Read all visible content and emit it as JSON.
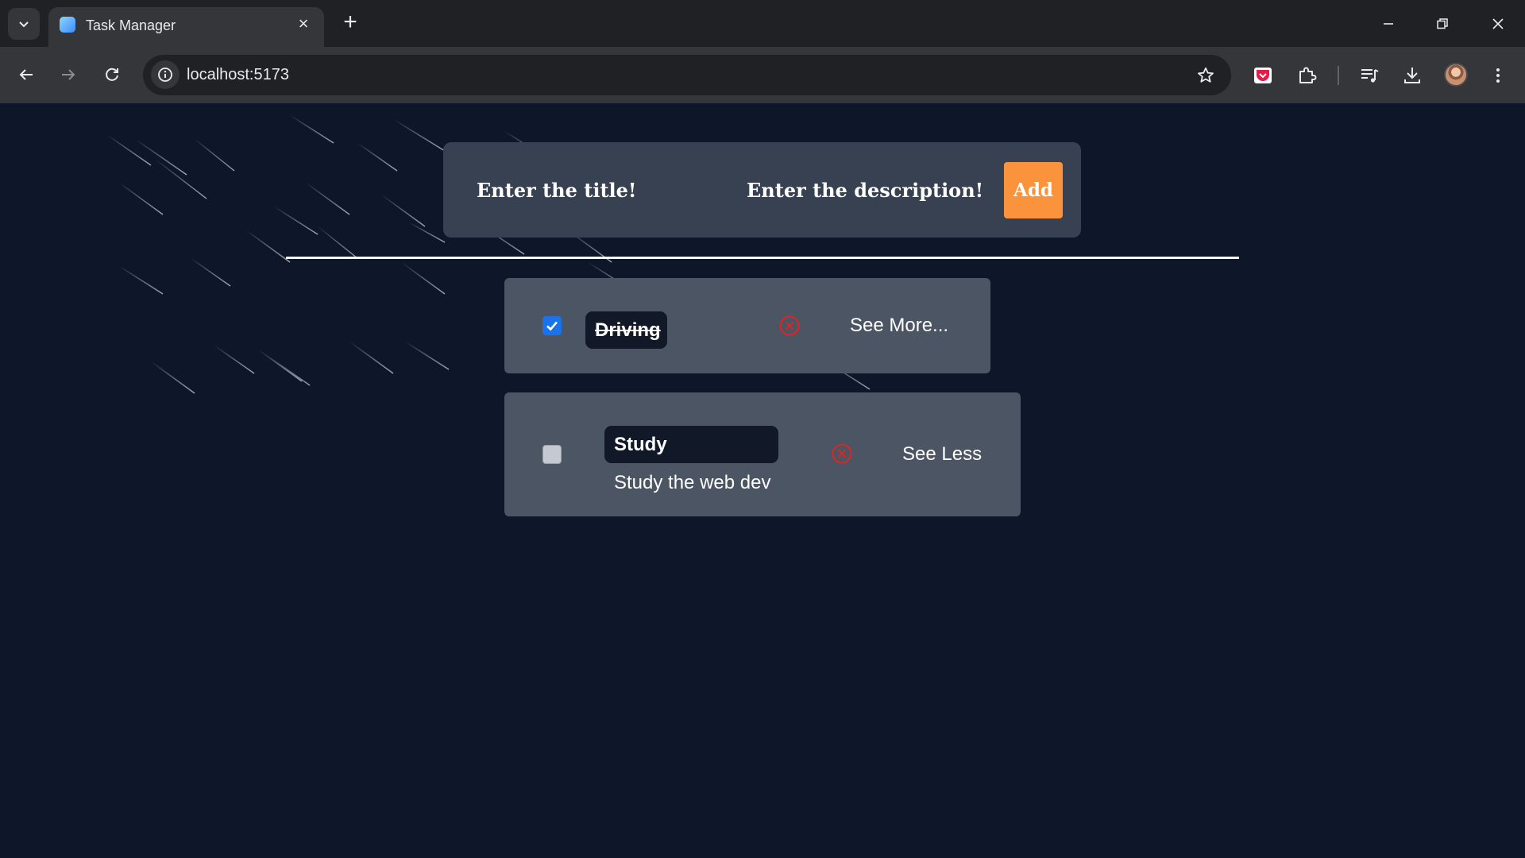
{
  "browser": {
    "tab_title": "Task Manager",
    "url": "localhost:5173"
  },
  "form": {
    "title_placeholder": "Enter the title!",
    "description_placeholder": "Enter the description!",
    "add_label": "Add"
  },
  "tasks": [
    {
      "title": "Driving",
      "completed": true,
      "toggle_label": "See More...",
      "description": ""
    },
    {
      "title": "Study",
      "completed": false,
      "toggle_label": "See Less",
      "description": "Study the web dev"
    }
  ],
  "colors": {
    "page_bg": "#0e1629",
    "panel_bg": "#374151",
    "card_bg": "#4b5563",
    "chip_bg": "#111827",
    "add_button": "#fb923c",
    "delete_icon": "#dc2626",
    "checkbox_checked": "#1a73e8"
  },
  "icons": {
    "tab_search": "chevron-down-icon",
    "delete": "close-circle-icon",
    "bookmark": "star-icon"
  }
}
